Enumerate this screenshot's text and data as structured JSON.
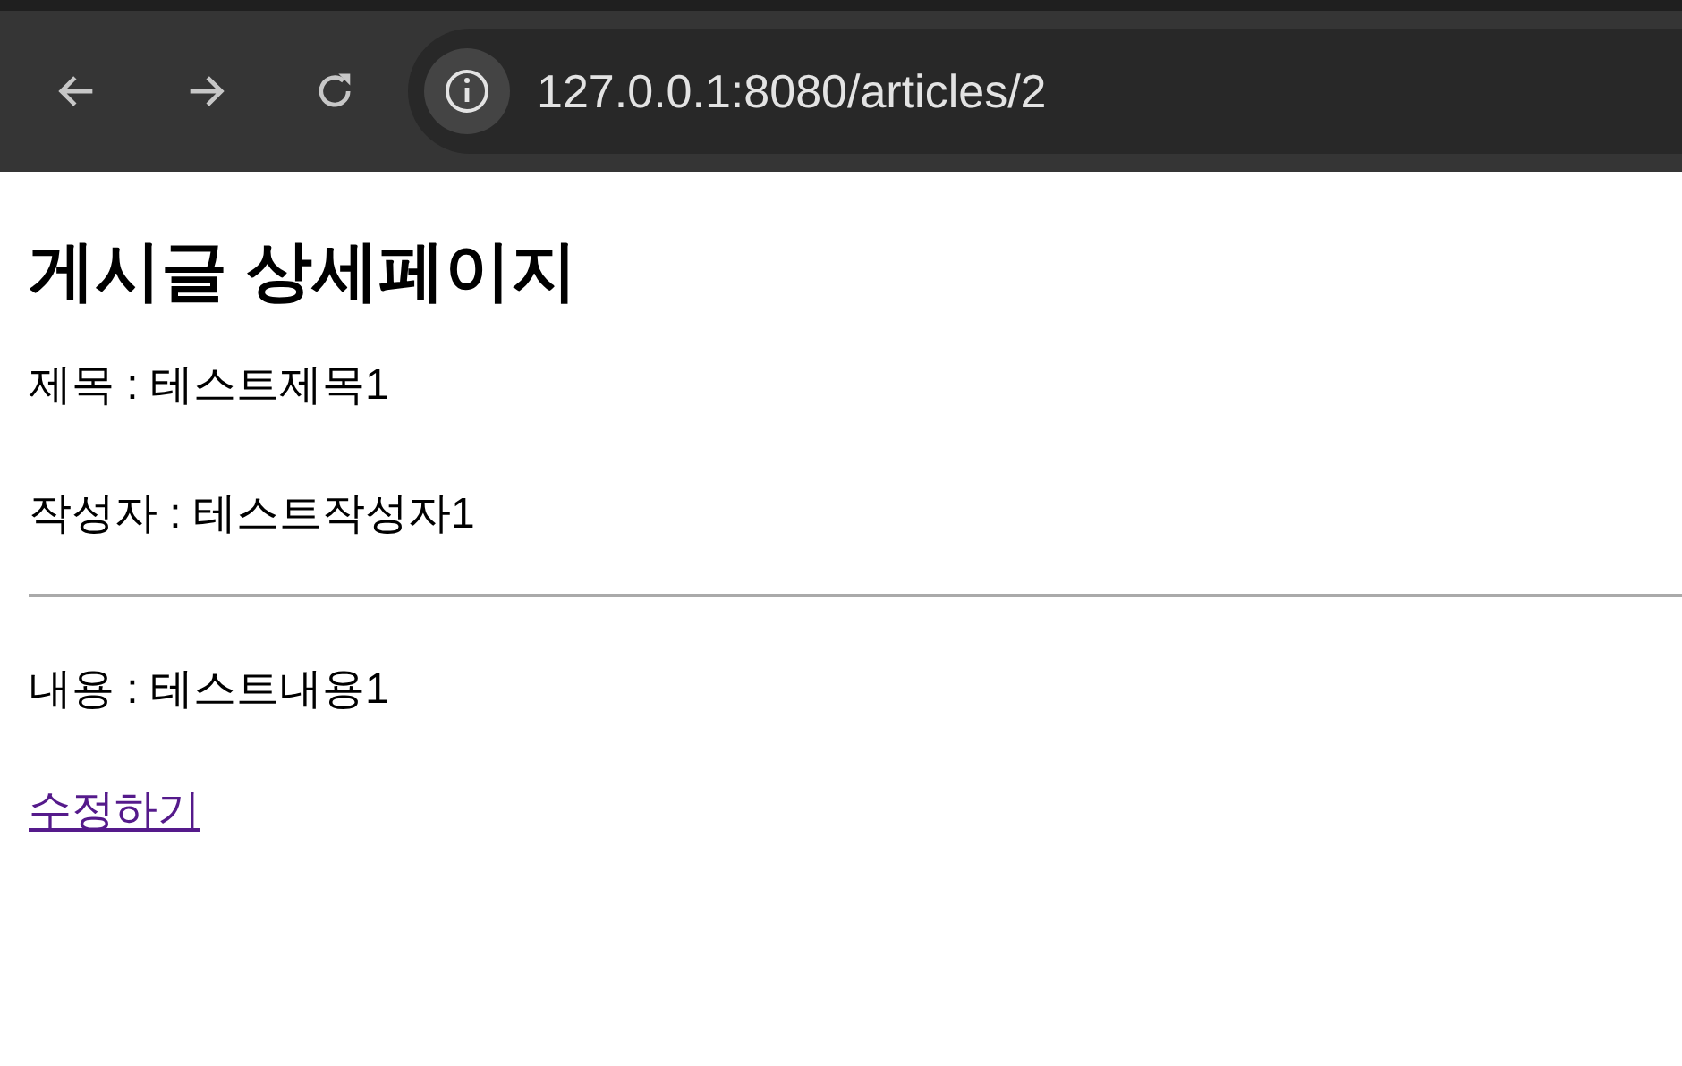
{
  "browser": {
    "url": "127.0.0.1:8080/articles/2"
  },
  "page": {
    "heading": "게시글 상세페이지",
    "details": [
      "제목 : 테스트제목1",
      "작성자 : 테스트작성자1"
    ],
    "content": "내용 : 테스트내용1",
    "link": "수정하기"
  }
}
